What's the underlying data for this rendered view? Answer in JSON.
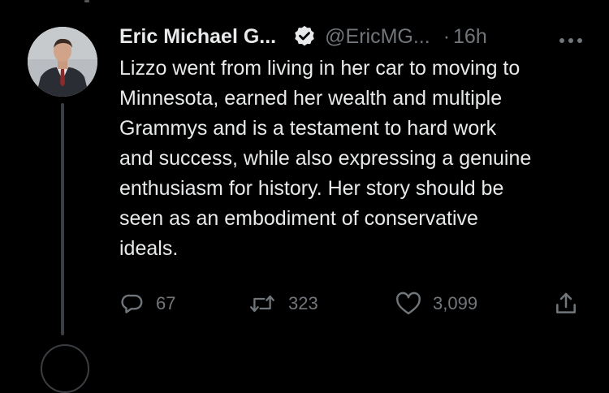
{
  "tweet": {
    "author_name": "Eric Michael G...",
    "handle": "@EricMG...",
    "separator": "·",
    "time": "16h",
    "text": "Lizzo went from living in her car to moving to\nMinnesota, earned her wealth and multiple\nGrammys and is a testament to hard work\nand success, while also expressing a genuine\nenthusiasm for history. Her story should be\nseen as an embodiment of conservative\nideals.",
    "verified": true
  },
  "actions": {
    "reply_count": "67",
    "retweet_count": "323",
    "like_count": "3,099"
  },
  "icons": {
    "verified": "verified-badge-icon",
    "more": "more-options-icon",
    "reply": "reply-icon",
    "retweet": "retweet-icon",
    "like": "heart-icon",
    "share": "share-icon"
  },
  "colors": {
    "background": "#000000",
    "text": "#e7e9ea",
    "muted": "#71767b",
    "thread_line": "#3a3e42"
  }
}
